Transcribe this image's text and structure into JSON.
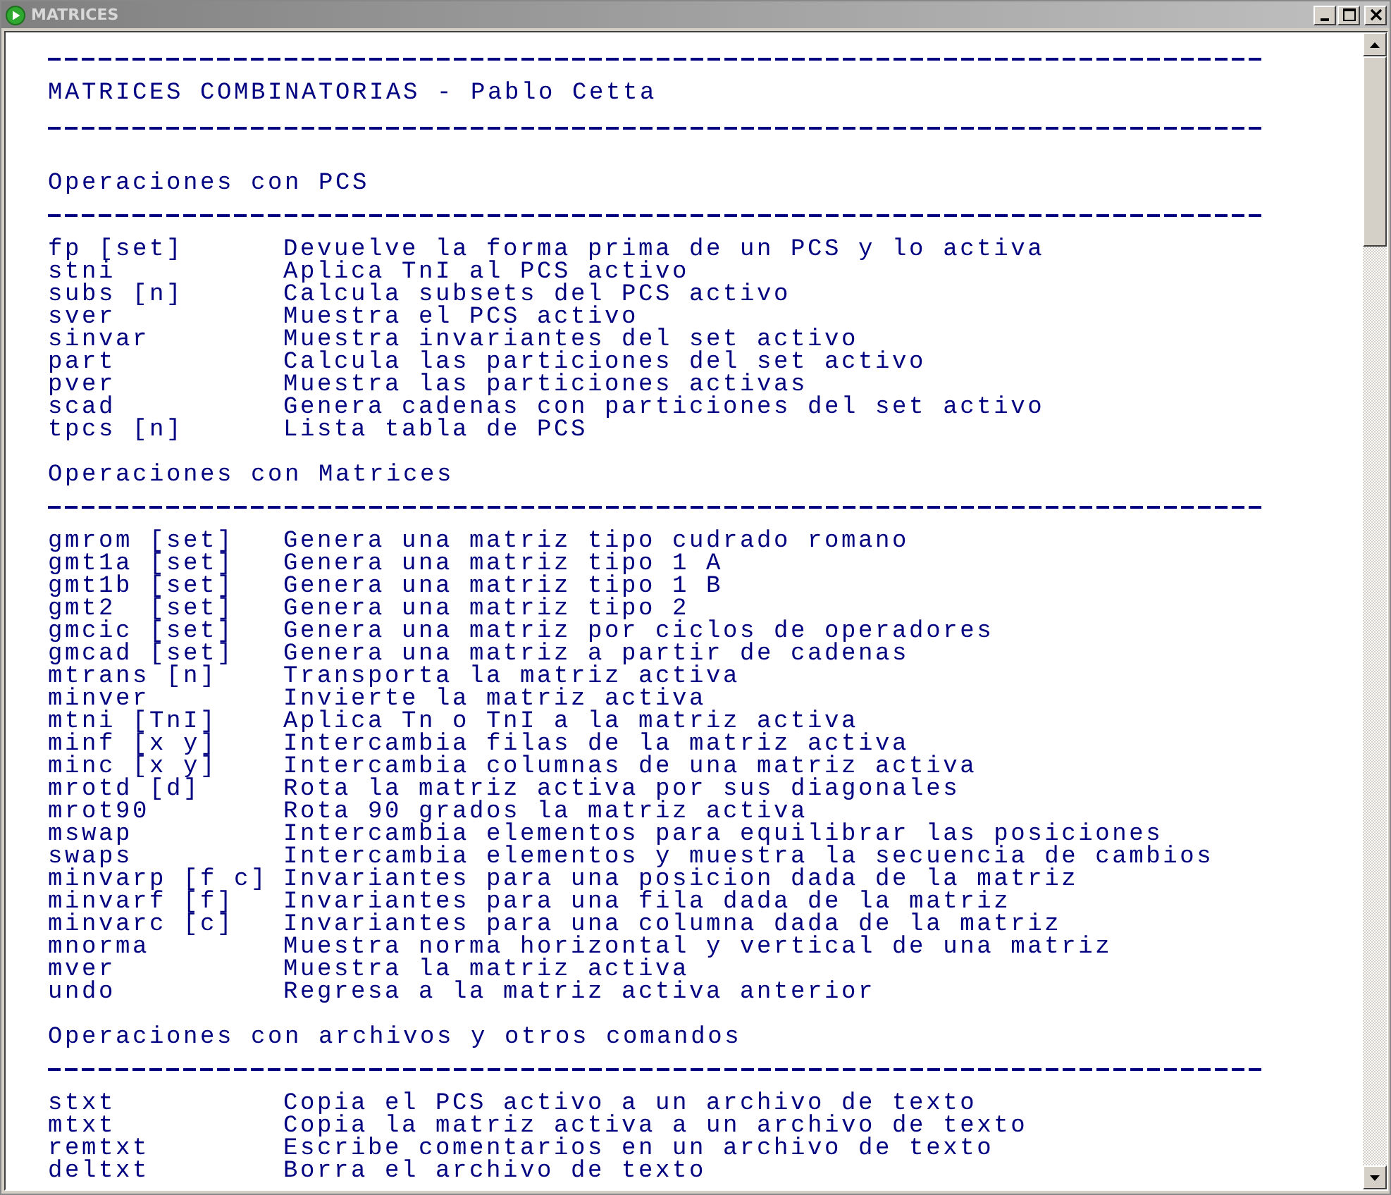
{
  "window": {
    "title": "MATRICES"
  },
  "header": "MATRICES COMBINATORIAS - Pablo Cetta",
  "sections": [
    {
      "heading": "Operaciones con PCS",
      "commands": [
        {
          "command": "fp [set]",
          "description": "Devuelve la forma prima de un PCS y lo activa"
        },
        {
          "command": "stni",
          "description": "Aplica TnI al PCS activo"
        },
        {
          "command": "subs [n]",
          "description": "Calcula subsets del PCS activo"
        },
        {
          "command": "sver",
          "description": "Muestra el PCS activo"
        },
        {
          "command": "sinvar",
          "description": "Muestra invariantes del set activo"
        },
        {
          "command": "part",
          "description": "Calcula las particiones del set activo"
        },
        {
          "command": "pver",
          "description": "Muestra las particiones activas"
        },
        {
          "command": "scad",
          "description": "Genera cadenas con particiones del set activo"
        },
        {
          "command": "tpcs [n]",
          "description": "Lista tabla de PCS"
        }
      ]
    },
    {
      "heading": "Operaciones con Matrices",
      "commands": [
        {
          "command": "gmrom [set]",
          "description": "Genera una matriz tipo cudrado romano"
        },
        {
          "command": "gmt1a [set]",
          "description": "Genera una matriz tipo 1 A"
        },
        {
          "command": "gmt1b [set]",
          "description": "Genera una matriz tipo 1 B"
        },
        {
          "command": "gmt2  [set]",
          "description": "Genera una matriz tipo 2"
        },
        {
          "command": "gmcic [set]",
          "description": "Genera una matriz por ciclos de operadores"
        },
        {
          "command": "gmcad [set]",
          "description": "Genera una matriz a partir de cadenas"
        },
        {
          "command": "mtrans [n]",
          "description": "Transporta la matriz activa"
        },
        {
          "command": "minver",
          "description": "Invierte la matriz activa"
        },
        {
          "command": "mtni [TnI]",
          "description": "Aplica Tn o TnI a la matriz activa"
        },
        {
          "command": "minf [x y]",
          "description": "Intercambia filas de la matriz activa"
        },
        {
          "command": "minc [x y]",
          "description": "Intercambia columnas de una matriz activa"
        },
        {
          "command": "mrotd [d]",
          "description": "Rota la matriz activa por sus diagonales"
        },
        {
          "command": "mrot90",
          "description": "Rota 90 grados la matriz activa"
        },
        {
          "command": "mswap",
          "description": "Intercambia elementos para equilibrar las posiciones"
        },
        {
          "command": "swaps",
          "description": "Intercambia elementos y muestra la secuencia de cambios"
        },
        {
          "command": "minvarp [f c]",
          "description": "Invariantes para una posicion dada de la matriz"
        },
        {
          "command": "minvarf [f]",
          "description": "Invariantes para una fila dada de la matriz"
        },
        {
          "command": "minvarc [c]",
          "description": "Invariantes para una columna dada de la matriz"
        },
        {
          "command": "mnorma",
          "description": "Muestra norma horizontal y vertical de una matriz"
        },
        {
          "command": "mver",
          "description": "Muestra la matriz activa"
        },
        {
          "command": "undo",
          "description": "Regresa a la matriz activa anterior"
        }
      ]
    },
    {
      "heading": "Operaciones con archivos y otros comandos",
      "commands": [
        {
          "command": "stxt",
          "description": "Copia el PCS activo a un archivo de texto"
        },
        {
          "command": "mtxt",
          "description": "Copia la matriz activa a un archivo de texto"
        },
        {
          "command": "remtxt",
          "description": "Escribe comentarios en un archivo de texto"
        },
        {
          "command": "deltxt",
          "description": "Borra el archivo de texto"
        }
      ]
    }
  ]
}
